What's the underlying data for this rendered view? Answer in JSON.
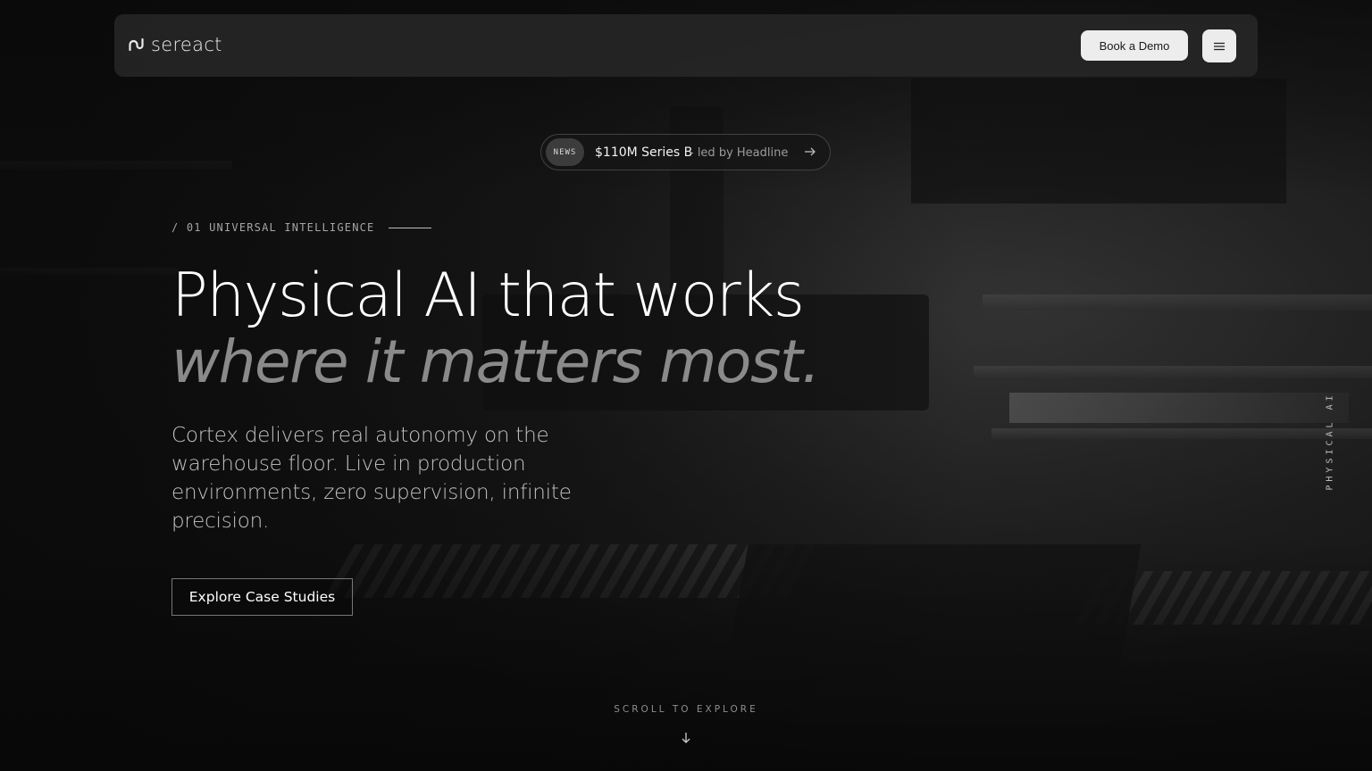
{
  "header": {
    "logo_text": "sereact",
    "demo_label": "Book a Demo",
    "menu_icon": "hamburger-menu-icon"
  },
  "news": {
    "badge": "NEWS",
    "headline": "$110M Series B",
    "sub": "- led by Headline",
    "arrow_icon": "arrow-right-icon"
  },
  "hero": {
    "eyebrow": "/ 01 UNIVERSAL INTELLIGENCE",
    "headline_line1": "Physical AI that works",
    "headline_line2": "where it matters most.",
    "lede": "Cortex delivers real autonomy on the warehouse floor. Live in production environments, zero supervision, infinite precision.",
    "cta_label": "Explore Case Studies"
  },
  "side_label": "PHYSICAL AI",
  "scroll": {
    "label": "SCROLL TO EXPLORE",
    "icon": "arrow-down-icon"
  },
  "colors": {
    "background": "#0d0d0d",
    "header_bg": "#282828",
    "button_bg": "#ededed",
    "headline_muted": "#8a8a8a"
  }
}
